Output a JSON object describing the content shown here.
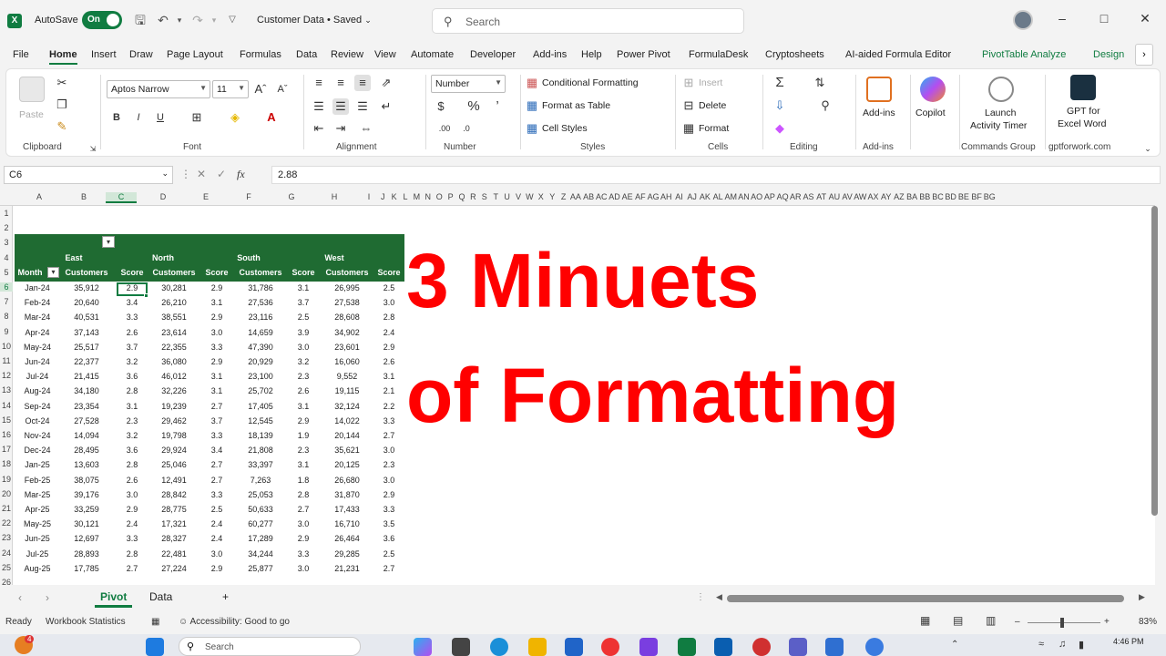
{
  "titlebar": {
    "autosave_label": "AutoSave",
    "autosave_state": "On",
    "document_title": "Customer Data • Saved",
    "search_placeholder": "Search"
  },
  "menu": [
    "File",
    "Home",
    "Insert",
    "Draw",
    "Page Layout",
    "Formulas",
    "Data",
    "Review",
    "View",
    "Automate",
    "Developer",
    "Add-ins",
    "Help",
    "Power Pivot",
    "FormulaDesk",
    "Cryptosheets",
    "AI-aided Formula Editor",
    "PivotTable Analyze",
    "Design"
  ],
  "ribbon": {
    "clipboard": {
      "paste": "Paste",
      "label": "Clipboard"
    },
    "font": {
      "name": "Aptos Narrow",
      "size": "11",
      "label": "Font"
    },
    "alignment": {
      "label": "Alignment"
    },
    "number": {
      "format": "Number",
      "label": "Number"
    },
    "styles": {
      "conditional": "Conditional Formatting",
      "format_table": "Format as Table",
      "cell_styles": "Cell Styles",
      "label": "Styles"
    },
    "cells": {
      "insert": "Insert",
      "delete": "Delete",
      "format": "Format",
      "label": "Cells"
    },
    "editing": {
      "label": "Editing"
    },
    "addins": {
      "btn": "Add-ins",
      "label": "Add-ins"
    },
    "copilot": {
      "btn": "Copilot"
    },
    "commands": {
      "btn1": "Launch",
      "btn2": "Activity Timer",
      "label": "Commands Group"
    },
    "gpt": {
      "btn1": "GPT for",
      "btn2": "Excel Word",
      "label": "gptforwork.com"
    }
  },
  "formula_bar": {
    "name_box": "C6",
    "fx": "fx",
    "value": "2.88"
  },
  "columns": [
    "A",
    "B",
    "C",
    "D",
    "E",
    "F",
    "G",
    "H",
    "I",
    "J",
    "K",
    "L",
    "M",
    "N",
    "O",
    "P",
    "Q",
    "R",
    "S",
    "T",
    "U",
    "V",
    "W",
    "X",
    "Y",
    "Z",
    "AA",
    "AB",
    "AC",
    "AD",
    "AE",
    "AF",
    "AG",
    "AH",
    "AI",
    "AJ",
    "AK",
    "AL",
    "AM",
    "AN",
    "AO",
    "AP",
    "AQ",
    "AR",
    "AS",
    "AT",
    "AU",
    "AV",
    "AW",
    "AX",
    "AY",
    "AZ",
    "BA",
    "BB",
    "BC",
    "BD",
    "BE",
    "BF",
    "BG"
  ],
  "rows": [
    "1",
    "2",
    "3",
    "4",
    "5",
    "6",
    "7",
    "8",
    "9",
    "10",
    "11",
    "12",
    "13",
    "14",
    "15",
    "16",
    "17",
    "18",
    "19",
    "20",
    "21",
    "22",
    "23",
    "24",
    "25",
    "26"
  ],
  "pivot": {
    "regions": [
      "East",
      "North",
      "South",
      "West"
    ],
    "month_header": "Month",
    "customers_header": "Customers",
    "score_header": "Score",
    "data": [
      [
        "Jan-24",
        "35,912",
        "2.9",
        "30,281",
        "2.9",
        "31,786",
        "3.1",
        "26,995",
        "2.5"
      ],
      [
        "Feb-24",
        "20,640",
        "3.4",
        "26,210",
        "3.1",
        "27,536",
        "3.7",
        "27,538",
        "3.0"
      ],
      [
        "Mar-24",
        "40,531",
        "3.3",
        "38,551",
        "2.9",
        "23,116",
        "2.5",
        "28,608",
        "2.8"
      ],
      [
        "Apr-24",
        "37,143",
        "2.6",
        "23,614",
        "3.0",
        "14,659",
        "3.9",
        "34,902",
        "2.4"
      ],
      [
        "May-24",
        "25,517",
        "3.7",
        "22,355",
        "3.3",
        "47,390",
        "3.0",
        "23,601",
        "2.9"
      ],
      [
        "Jun-24",
        "22,377",
        "3.2",
        "36,080",
        "2.9",
        "20,929",
        "3.2",
        "16,060",
        "2.6"
      ],
      [
        "Jul-24",
        "21,415",
        "3.6",
        "46,012",
        "3.1",
        "23,100",
        "2.3",
        "9,552",
        "3.1"
      ],
      [
        "Aug-24",
        "34,180",
        "2.8",
        "32,226",
        "3.1",
        "25,702",
        "2.6",
        "19,115",
        "2.1"
      ],
      [
        "Sep-24",
        "23,354",
        "3.1",
        "19,239",
        "2.7",
        "17,405",
        "3.1",
        "32,124",
        "2.2"
      ],
      [
        "Oct-24",
        "27,528",
        "2.3",
        "29,462",
        "3.7",
        "12,545",
        "2.9",
        "14,022",
        "3.3"
      ],
      [
        "Nov-24",
        "14,094",
        "3.2",
        "19,798",
        "3.3",
        "18,139",
        "1.9",
        "20,144",
        "2.7"
      ],
      [
        "Dec-24",
        "28,495",
        "3.6",
        "29,924",
        "3.4",
        "21,808",
        "2.3",
        "35,621",
        "3.0"
      ],
      [
        "Jan-25",
        "13,603",
        "2.8",
        "25,046",
        "2.7",
        "33,397",
        "3.1",
        "20,125",
        "2.3"
      ],
      [
        "Feb-25",
        "38,075",
        "2.6",
        "12,491",
        "2.7",
        "7,263",
        "1.8",
        "26,680",
        "3.0"
      ],
      [
        "Mar-25",
        "39,176",
        "3.0",
        "28,842",
        "3.3",
        "25,053",
        "2.8",
        "31,870",
        "2.9"
      ],
      [
        "Apr-25",
        "33,259",
        "2.9",
        "28,775",
        "2.5",
        "50,633",
        "2.7",
        "17,433",
        "3.3"
      ],
      [
        "May-25",
        "30,121",
        "2.4",
        "17,321",
        "2.4",
        "60,277",
        "3.0",
        "16,710",
        "3.5"
      ],
      [
        "Jun-25",
        "12,697",
        "3.3",
        "28,327",
        "2.4",
        "17,289",
        "2.9",
        "26,464",
        "3.6"
      ],
      [
        "Jul-25",
        "28,893",
        "2.8",
        "22,481",
        "3.0",
        "34,244",
        "3.3",
        "29,285",
        "2.5"
      ],
      [
        "Aug-25",
        "17,785",
        "2.7",
        "27,224",
        "2.9",
        "25,877",
        "3.0",
        "21,231",
        "2.7"
      ]
    ]
  },
  "overlay": {
    "line1": "3 Minuets",
    "line2": "of Formatting",
    "color": "#ff0000"
  },
  "sheet_tabs": {
    "tab1": "Pivot",
    "tab2": "Data",
    "add": "+"
  },
  "status": {
    "ready": "Ready",
    "stats": "Workbook Statistics",
    "access": "Accessibility: Good to go",
    "zoom": "83%"
  },
  "taskbar": {
    "search": "Search",
    "time": "4:46 PM",
    "badge": "4"
  }
}
